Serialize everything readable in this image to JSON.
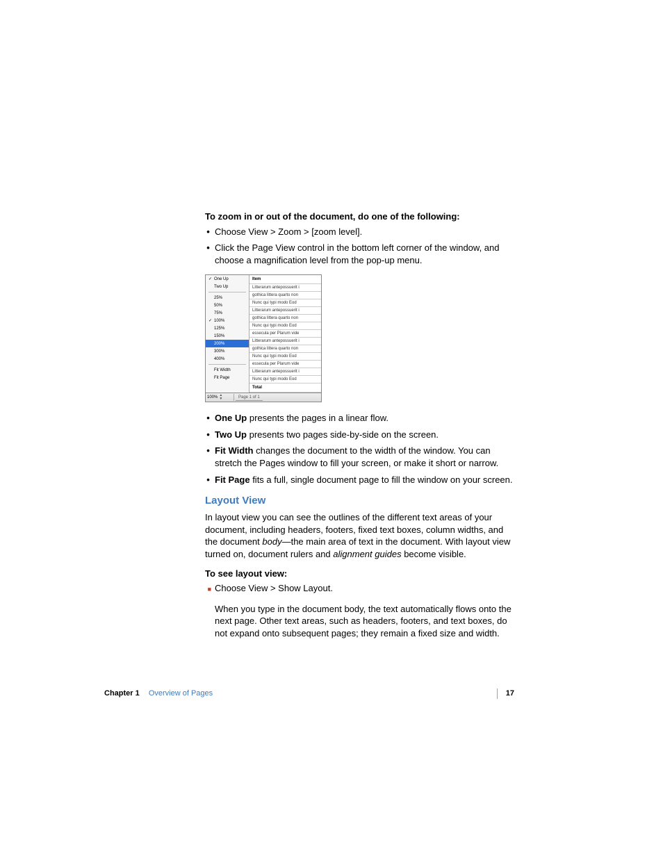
{
  "zoom": {
    "heading": "To zoom in or out of the document, do one of the following:",
    "bullets": [
      "Choose View > Zoom > [zoom level].",
      "Click the Page View control in the bottom left corner of the window, and choose a magnification level from the pop-up menu."
    ]
  },
  "menu": {
    "layout": [
      "One Up",
      "Two Up"
    ],
    "group1": [
      "25%",
      "50%",
      "75%",
      "100%",
      "125%",
      "150%"
    ],
    "group2": [
      "200%",
      "300%",
      "400%"
    ],
    "fit": [
      "Fit Width",
      "Fit Page"
    ],
    "checked": {
      "layout": "One Up",
      "zoom": "100%"
    },
    "selected": "200%",
    "status": {
      "zoom": "100%",
      "page": "Page 1 of 1"
    },
    "docHeader": "Item",
    "docRows": [
      "Litterarum antepossuerit i",
      "gothica littera quarto non",
      "Nunc qui typi modo Eod",
      "Litterarum antepossuerit i",
      "gothica littera quarto non",
      "Nunc qui typi modo Eod",
      "essecula per Plarum vide",
      "Litterarum antepossuerit i",
      "gothica littera quarto non",
      "Nunc qui typi modo Eod",
      "essecula per Plarum vide",
      "Litterarum antepossuerit i",
      "Nunc qui typi modo Eod"
    ],
    "docTotal": "Total"
  },
  "views": [
    {
      "term": "One Up",
      "desc": " presents the pages in a linear flow."
    },
    {
      "term": "Two Up",
      "desc": " presents two pages side-by-side on the screen."
    },
    {
      "term": "Fit Width",
      "desc": " changes the document to the width of the window. You can stretch the Pages window to fill your screen, or make it short or narrow."
    },
    {
      "term": "Fit Page",
      "desc": " fits a full, single document page to fill the window on your screen."
    }
  ],
  "layoutView": {
    "heading": "Layout View",
    "p1a": "In layout view you can see the outlines of the different text areas of your document, including headers, footers, fixed text boxes, column widths, and the document ",
    "p1i": "body",
    "p1b": "—the main area of text in the document. With layout view turned on, document rulers and ",
    "p1i2": "alignment guides",
    "p1c": " become visible.",
    "subhead": "To see layout view:",
    "step": "Choose View > Show Layout.",
    "p2": "When you type in the document body, the text automatically flows onto the next page. Other text areas, such as headers, footers, and text boxes, do not expand onto subsequent pages; they remain a fixed size and width."
  },
  "footer": {
    "chapter": "Chapter 1",
    "title": "Overview of Pages",
    "page": "17"
  }
}
